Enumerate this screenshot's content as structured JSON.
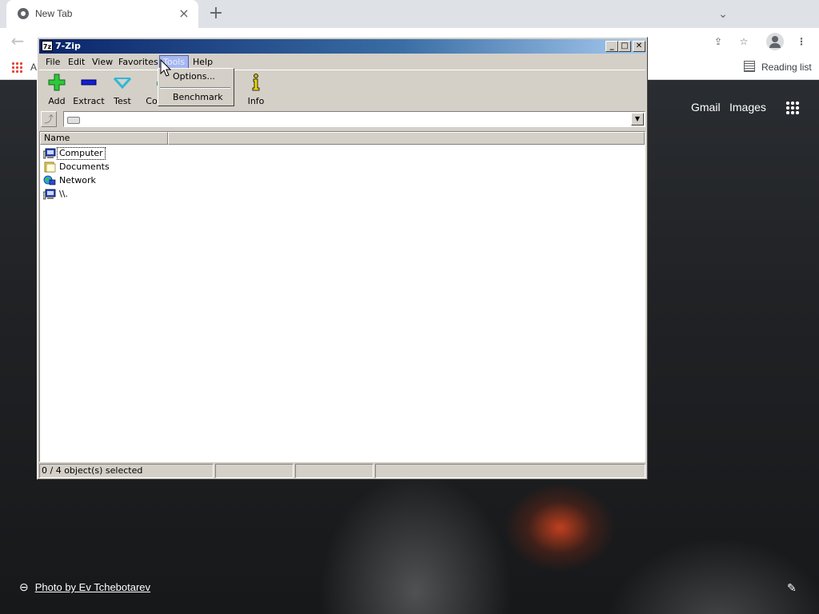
{
  "browser": {
    "tab_title": "New Tab",
    "tab_close": "×",
    "new_tab": "+",
    "back": "←",
    "bookmarks_apps_label": "A",
    "reading_list": "Reading list",
    "ntp_links": [
      "Gmail",
      "Images"
    ],
    "photo_credit": "Photo by Ev Tchebotarev"
  },
  "window": {
    "title": "7-Zip",
    "icon_text": "7z",
    "controls": {
      "minimize": "_",
      "maximize": "□",
      "close": "✕"
    }
  },
  "menu": [
    "File",
    "Edit",
    "View",
    "Favorites",
    "Tools",
    "Help"
  ],
  "tools_menu": {
    "options": "Options...",
    "benchmark": "Benchmark"
  },
  "toolbar": [
    {
      "label": "Add",
      "icon": "add-icon"
    },
    {
      "label": "Extract",
      "icon": "extract-icon"
    },
    {
      "label": "Test",
      "icon": "test-icon"
    },
    {
      "label": "Cop",
      "icon": "copy-icon"
    },
    {
      "label": "Info",
      "icon": "info-icon"
    }
  ],
  "address": {
    "path": ""
  },
  "columns": {
    "name": "Name"
  },
  "items": [
    {
      "label": "Computer",
      "icon": "computer-icon"
    },
    {
      "label": "Documents",
      "icon": "documents-icon"
    },
    {
      "label": "Network",
      "icon": "network-icon"
    },
    {
      "label": "\\\\.",
      "icon": "computer-icon"
    }
  ],
  "status": {
    "selected": "0 / 4 object(s) selected"
  },
  "colors": {
    "title_active": "#0a246a",
    "face": "#d4d0c8",
    "menu_highlight": "#a6b6f0"
  }
}
